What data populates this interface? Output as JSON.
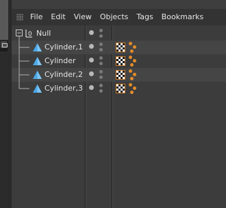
{
  "menu": [
    "File",
    "Edit",
    "View",
    "Objects",
    "Tags",
    "Bookmarks"
  ],
  "objects": [
    {
      "name": "Null",
      "type": "null",
      "icon": "null-object-icon",
      "expanded": true,
      "has_tags": false
    },
    {
      "name": "Cylinder,1",
      "type": "cylinder",
      "icon": "cylinder-icon",
      "has_tags": true
    },
    {
      "name": "Cylinder",
      "type": "cylinder",
      "icon": "cylinder-icon",
      "has_tags": true
    },
    {
      "name": "Cylinder,2",
      "type": "cylinder",
      "icon": "cylinder-icon",
      "has_tags": true
    },
    {
      "name": "Cylinder,3",
      "type": "cylinder",
      "icon": "cylinder-icon",
      "has_tags": true
    }
  ],
  "tags": [
    "texture-tag-icon",
    "phong-tag-icon"
  ],
  "colors": {
    "background": "#3c3c3c",
    "menubar": "#333333",
    "tag_accent": "#e38b2a"
  }
}
